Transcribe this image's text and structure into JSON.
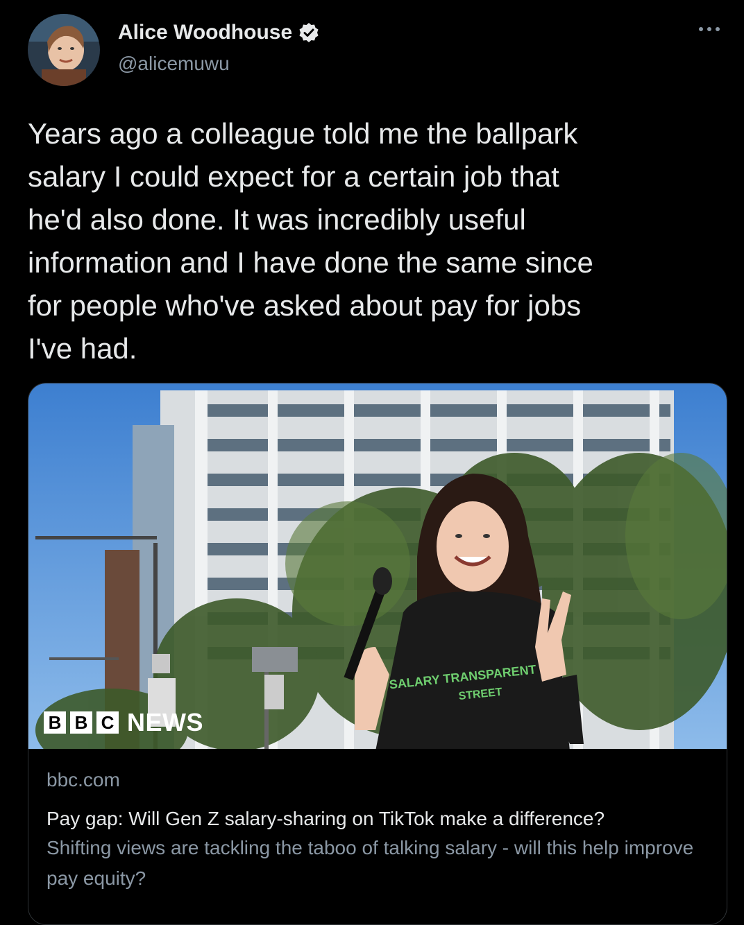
{
  "author": {
    "name": "Alice Woodhouse",
    "handle": "@alicemuwu",
    "verified": true
  },
  "icons": {
    "verified": "verified-badge-icon",
    "more": "more-options-icon"
  },
  "tweet": {
    "text": "Years ago a colleague told me the ballpark\nsalary I could expect for a certain job that\nhe'd also done. It was incredibly useful\ninformation and I have done the same since\nfor people who've asked about pay for jobs\nI've had."
  },
  "card": {
    "logo": {
      "letters": [
        "B",
        "B",
        "C"
      ],
      "news": "NEWS"
    },
    "shirt_text": "SALARY TRANSPARENT STREET",
    "domain": "bbc.com",
    "title": "Pay gap: Will Gen Z salary-sharing on TikTok make a difference?",
    "description": "Shifting views are tackling the taboo of talking salary - will this help improve pay equity?"
  },
  "colors": {
    "background": "#000000",
    "text": "#e7e9ea",
    "secondary": "#8b98a5",
    "border": "#2f3336"
  }
}
